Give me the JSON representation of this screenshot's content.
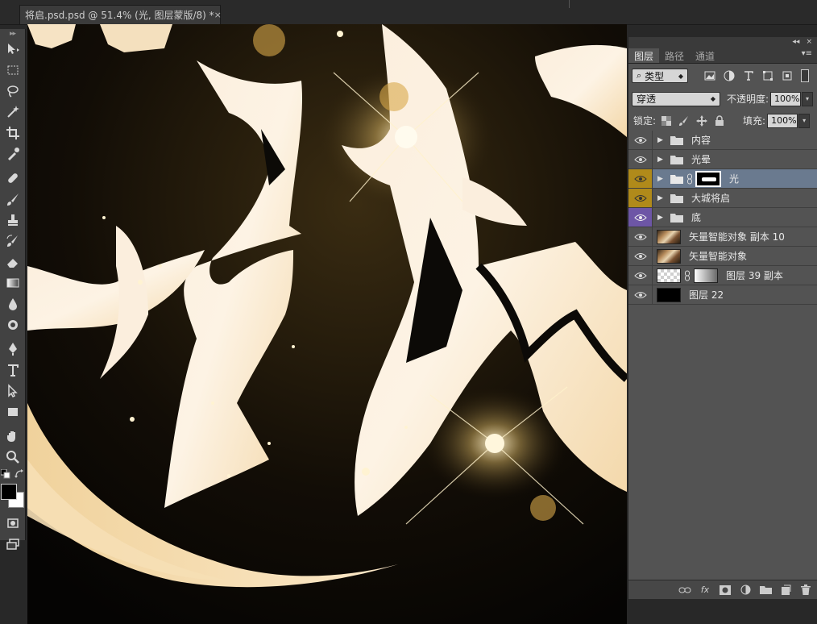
{
  "document": {
    "tab_title": "将启.psd.psd @ 51.4% (光, 图层蒙版/8) *",
    "close_glyph": "×"
  },
  "layers_panel": {
    "tabs": [
      {
        "label": "图层",
        "active": true
      },
      {
        "label": "路径",
        "active": false
      },
      {
        "label": "通道",
        "active": false
      }
    ],
    "filter_kind_label": "类型",
    "blend_mode": "穿透",
    "opacity_label": "不透明度:",
    "opacity_value": "100%",
    "lock_label": "锁定:",
    "fill_label": "填充:",
    "fill_value": "100%",
    "layers": [
      {
        "name": "内容",
        "type": "group",
        "tag_color": null,
        "selected": false
      },
      {
        "name": "光晕",
        "type": "group",
        "tag_color": null,
        "selected": false
      },
      {
        "name": "光",
        "type": "group-mask",
        "tag_color": "#b08a1a",
        "selected": true
      },
      {
        "name": "大城将启",
        "type": "group",
        "tag_color": "#b08a1a",
        "selected": false
      },
      {
        "name": "底",
        "type": "group",
        "tag_color": "#6d56a6",
        "selected": false
      },
      {
        "name": "矢量智能对象 副本 10",
        "type": "smart",
        "tag_color": null,
        "selected": false
      },
      {
        "name": "矢量智能对象",
        "type": "smart",
        "tag_color": null,
        "selected": false
      },
      {
        "name": "图层 39 副本",
        "type": "pixel-mask",
        "tag_color": null,
        "selected": false
      },
      {
        "name": "图层 22",
        "type": "pixel-black",
        "tag_color": null,
        "selected": false
      }
    ]
  },
  "tools": [
    "move-tool",
    "marquee-tool",
    "lasso-tool",
    "magic-wand-tool",
    "crop-tool",
    "eyedropper-tool",
    "healing-brush-tool",
    "brush-tool",
    "clone-stamp-tool",
    "history-brush-tool",
    "eraser-tool",
    "gradient-tool",
    "blur-tool",
    "dodge-tool",
    "pen-tool",
    "type-tool",
    "path-selection-tool",
    "rectangle-tool",
    "hand-tool",
    "zoom-tool"
  ],
  "colors": {
    "foreground": "#000000",
    "background": "#ffffff",
    "highlight": "#fbeedd"
  }
}
